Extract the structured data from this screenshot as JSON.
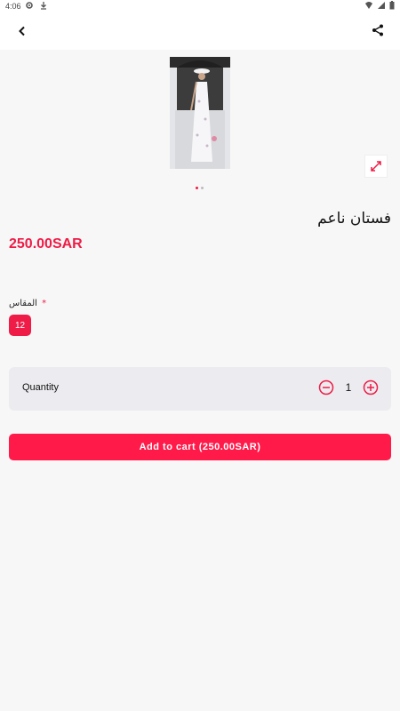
{
  "status": {
    "time": "4:06",
    "icons": [
      "gear-icon",
      "download-icon",
      "wifi-icon",
      "signal-icon",
      "battery-icon"
    ]
  },
  "appbar": {
    "back_icon": "chevron-left-icon",
    "share_icon": "share-icon"
  },
  "product": {
    "image_icon": "product-photo",
    "expand_icon": "expand-icon",
    "title": "فستان ناعم",
    "price": "250.00SAR",
    "size": {
      "label": "المقاس",
      "required_mark": "*",
      "options": [
        "12"
      ],
      "selected": "12"
    },
    "quantity": {
      "label": "Quantity",
      "value": "1"
    },
    "add_to_cart_label": "Add to cart (250.00SAR)"
  },
  "colors": {
    "accent": "#ee1c47",
    "button": "#ff1a4a",
    "background": "#f7f7f7",
    "card": "#ececf0"
  }
}
